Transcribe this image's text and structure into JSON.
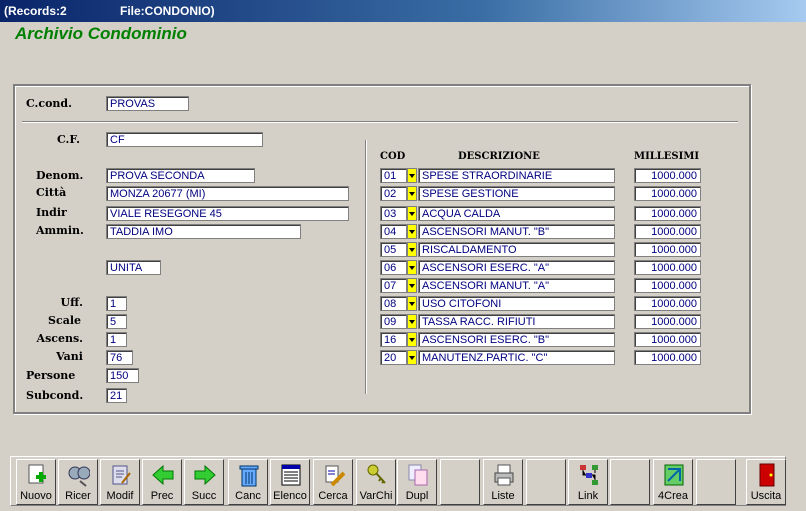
{
  "window": {
    "records": "(Records:2",
    "file": "File:CONDONIO)"
  },
  "app_title": "Archivio Condominio",
  "labels": {
    "ccond": "C.cond.",
    "cf": "C.F.",
    "denom": "Denom.",
    "citta": "Città",
    "indir": "Indir",
    "ammin": "Ammin.",
    "uff": "Uff.",
    "scale": "Scale",
    "ascens": "Ascens.",
    "vani": "Vani",
    "persone": "Persone",
    "subcond": "Subcond."
  },
  "fields": {
    "ccond": "PROVAS",
    "cf": "CF",
    "denom": "PROVA SECONDA",
    "citta": "MONZA  20677   (MI)",
    "indir": "VIALE RESEGONE 45",
    "ammin": "TADDIA IMO",
    "unita": "UNITA",
    "uff": "1",
    "scale": "5",
    "ascens": "1",
    "vani": "76",
    "persone": "150",
    "subcond": "21"
  },
  "table": {
    "headers": {
      "cod": "COD",
      "descrizione": "DESCRIZIONE",
      "millesimi": "MILLESIMI"
    },
    "rows": [
      {
        "cod": "01",
        "desc": "SPESE STRAORDINARIE",
        "mill": "1000.000"
      },
      {
        "cod": "02",
        "desc": "SPESE GESTIONE",
        "mill": "1000.000"
      },
      {
        "cod": "03",
        "desc": "ACQUA CALDA",
        "mill": "1000.000"
      },
      {
        "cod": "04",
        "desc": "ASCENSORI MANUT. \"B\"",
        "mill": "1000.000"
      },
      {
        "cod": "05",
        "desc": "RISCALDAMENTO",
        "mill": "1000.000"
      },
      {
        "cod": "06",
        "desc": "ASCENSORI ESERC. \"A\"",
        "mill": "1000.000"
      },
      {
        "cod": "07",
        "desc": "ASCENSORI MANUT. \"A\"",
        "mill": "1000.000"
      },
      {
        "cod": "08",
        "desc": "USO CITOFONI",
        "mill": "1000.000"
      },
      {
        "cod": "09",
        "desc": "TASSA RACC. RIFIUTI",
        "mill": "1000.000"
      },
      {
        "cod": "16",
        "desc": "ASCENSORI ESERC. \"B\"",
        "mill": "1000.000"
      },
      {
        "cod": "20",
        "desc": "MANUTENZ.PARTIC. \"C\"",
        "mill": "1000.000"
      }
    ]
  },
  "toolbar": {
    "buttons": [
      {
        "label": "Nuovo",
        "icon": "new-document-icon"
      },
      {
        "label": "Ricer",
        "icon": "search-binoculars-icon"
      },
      {
        "label": "Modif",
        "icon": "edit-document-icon"
      },
      {
        "label": "Prec",
        "icon": "arrow-left-icon"
      },
      {
        "label": "Succ",
        "icon": "arrow-right-icon"
      },
      {
        "label": "Canc",
        "icon": "trash-icon"
      },
      {
        "label": "Elenco",
        "icon": "list-table-icon"
      },
      {
        "label": "Cerca",
        "icon": "highlight-search-icon"
      },
      {
        "label": "VarChi",
        "icon": "keys-icon"
      },
      {
        "label": "Dupl",
        "icon": "duplicate-icon"
      },
      {
        "label": "",
        "icon": ""
      },
      {
        "label": "Liste",
        "icon": "printer-icon"
      },
      {
        "label": "",
        "icon": ""
      },
      {
        "label": "Link",
        "icon": "link-tree-icon"
      },
      {
        "label": "",
        "icon": ""
      },
      {
        "label": "4Crea",
        "icon": "create-icon"
      },
      {
        "label": "",
        "icon": ""
      },
      {
        "label": "Uscita",
        "icon": "exit-door-icon"
      }
    ]
  },
  "colors": {
    "title_green": "#008000",
    "field_text": "#000080",
    "dropdown_yellow": "#ffff00"
  }
}
